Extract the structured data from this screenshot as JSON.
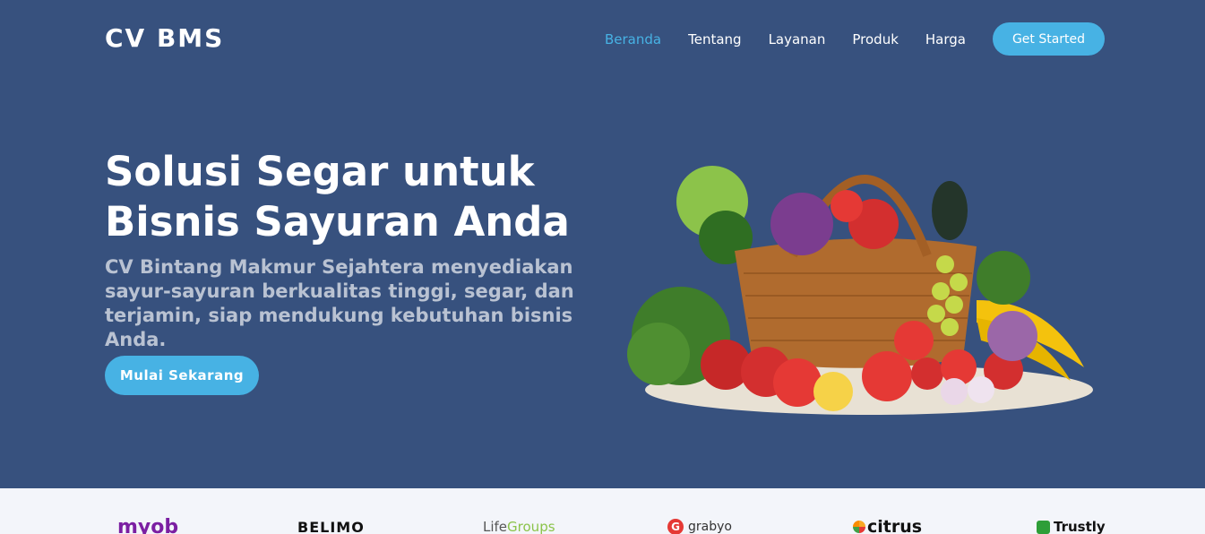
{
  "header": {
    "brand": "CV BMS",
    "nav": [
      {
        "label": "Beranda",
        "active": true
      },
      {
        "label": "Tentang",
        "active": false
      },
      {
        "label": "Layanan",
        "active": false
      },
      {
        "label": "Produk",
        "active": false
      },
      {
        "label": "Harga",
        "active": false
      }
    ],
    "cta_label": "Get Started"
  },
  "hero": {
    "title": "Solusi Segar untuk Bisnis Sayuran Anda",
    "subtitle": "CV Bintang Makmur Sejahtera menyediakan sayur-sayuran berkualitas tinggi, segar, dan terjamin, siap mendukung kebutuhan bisnis Anda.",
    "button_label": "Mulai Sekarang"
  },
  "clients": {
    "myob": "myob",
    "belimo": "BELIMO",
    "lifegroups_a": "Life",
    "lifegroups_b": "Groups",
    "grabyo_mark": "G",
    "grabyo": "grabyo",
    "citrus": "citrus",
    "trustly": "Trustly"
  },
  "colors": {
    "hero_bg": "#37517e",
    "accent": "#47b2e4",
    "clients_bg": "#f3f5fa"
  }
}
